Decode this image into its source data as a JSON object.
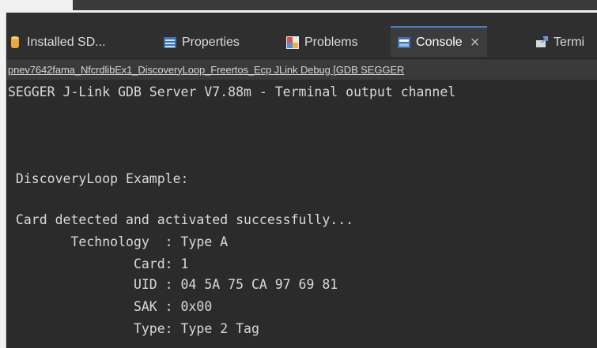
{
  "tabs": [
    {
      "label": "Installed SD...",
      "icon": "cylinder-icon"
    },
    {
      "label": "Properties",
      "icon": "properties-icon"
    },
    {
      "label": "Problems",
      "icon": "problems-icon"
    },
    {
      "label": "Console",
      "icon": "console-icon",
      "active": true
    },
    {
      "label": "Termi",
      "icon": "terminal-icon"
    }
  ],
  "console": {
    "launch_title": "pnev7642fama_NfcrdlibEx1_DiscoveryLoop_Freertos_Ecp JLink Debug [GDB SEGGER",
    "lines": [
      "SEGGER J-Link GDB Server V7.88m - Terminal output channel",
      "",
      " DiscoveryLoop Example:",
      "",
      " Card detected and activated successfully...",
      "        Technology  : Type A",
      "                Card: 1",
      "                UID : 04 5A 75 CA 97 69 81",
      "                SAK : 0x00",
      "                Type: Type 2 Tag"
    ]
  },
  "colors": {
    "console_bg": "#2b2b2b",
    "tab_active_border": "#4a7fc8",
    "text": "#d9d9d9"
  }
}
